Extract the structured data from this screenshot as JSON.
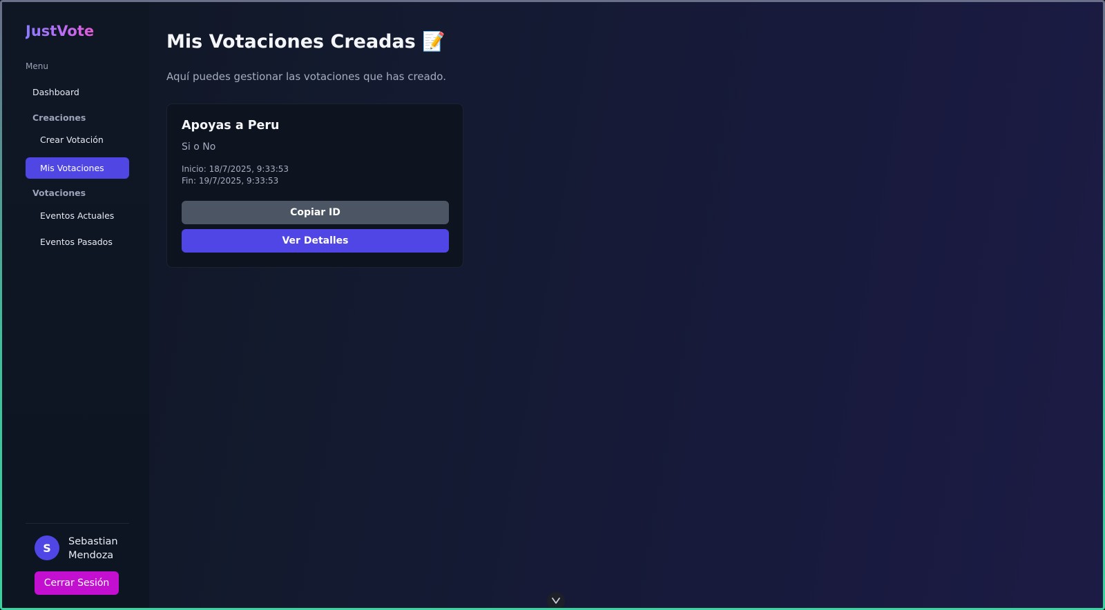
{
  "brand": "JustVote",
  "sidebar": {
    "menu_label": "Menu",
    "dashboard": "Dashboard",
    "section_creaciones": "Creaciones",
    "crear_votacion": "Crear Votación",
    "mis_votaciones": "Mis Votaciones",
    "section_votaciones": "Votaciones",
    "eventos_actuales": "Eventos Actuales",
    "eventos_pasados": "Eventos Pasados",
    "active_item": "Mis Votaciones"
  },
  "user": {
    "initial": "S",
    "name": "Sebastian Mendoza",
    "logout_label": "Cerrar Sesión"
  },
  "main": {
    "title": "Mis Votaciones Creadas 📝",
    "subtitle": "Aquí puedes gestionar las votaciones que has creado."
  },
  "votes": [
    {
      "title": "Apoyas a Peru",
      "description": "Si o No",
      "start": "Inicio: 18/7/2025, 9:33:53",
      "end": "Fin: 19/7/2025, 9:33:53",
      "copy_label": "Copiar ID",
      "details_label": "Ver Detalles"
    }
  ],
  "bottom_toggle_icon": "chevron-down-icon",
  "colors": {
    "accent": "#4f46e5",
    "logout": "#c20fd0",
    "copy_button": "#4b5563"
  }
}
